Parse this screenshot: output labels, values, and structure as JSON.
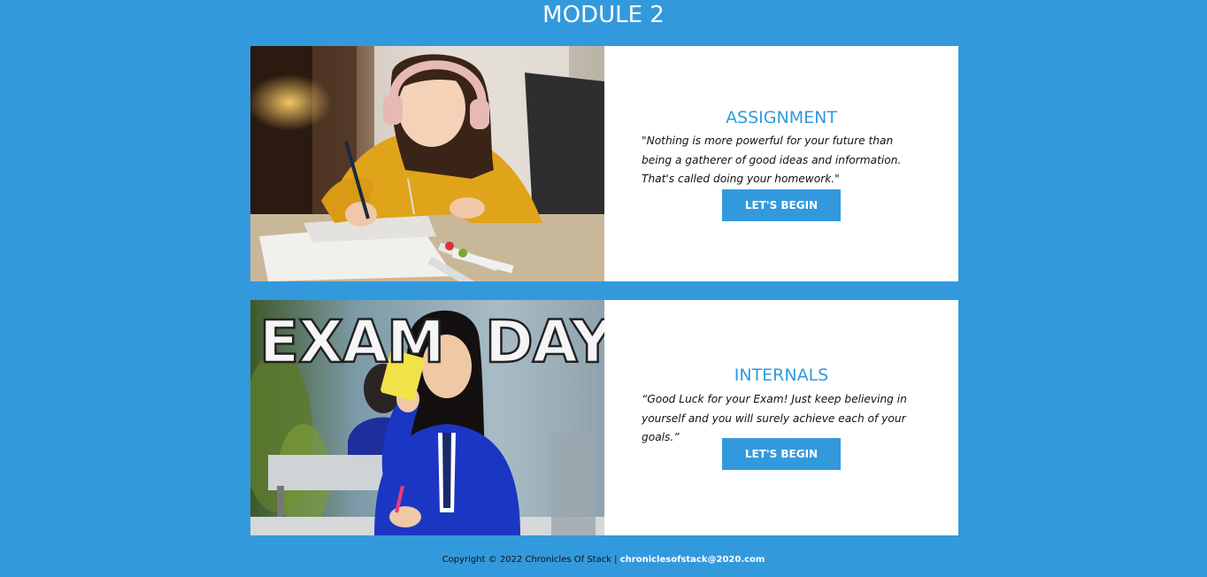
{
  "page": {
    "title": "MODULE 2"
  },
  "cards": [
    {
      "heading": "ASSIGNMENT",
      "quote": "\"Nothing is more powerful for your future than being a gatherer of good ideas and information. That's called doing your homework.\"",
      "button_label": "LET'S BEGIN",
      "image": "girl-with-headphones-doing-homework-photo"
    },
    {
      "heading": "INTERNALS",
      "quote": "“Good Luck for your Exam! Just keep believing in yourself and you will surely achieve each of your goals.”",
      "button_label": "LET'S BEGIN",
      "image": "exam-day-student-photo",
      "image_text_left": "EXAM",
      "image_text_right": "DAY"
    }
  ],
  "footer": {
    "copyright": "Copyright © 2022 Chronicles Of Stack | ",
    "email": "chroniclesofstack@2020.com"
  },
  "colors": {
    "background": "#3399dd",
    "accent": "#3399dd",
    "card": "#ffffff"
  }
}
